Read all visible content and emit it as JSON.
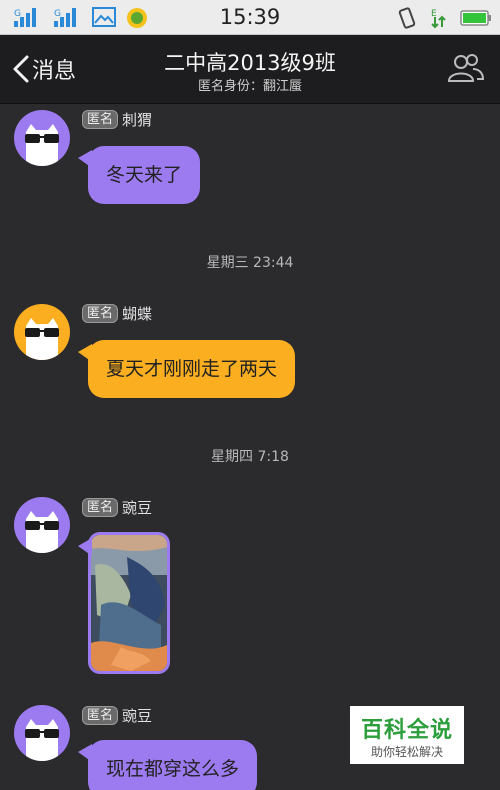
{
  "status_bar": {
    "time": "15:39",
    "signal1_label": "G",
    "signal2_label": "G",
    "data_label": "E"
  },
  "nav": {
    "back_label": "消息",
    "title": "二中高2013级9班",
    "subtitle": "匿名身份：翻江蜃"
  },
  "messages": [
    {
      "tag": "匿名",
      "nick": "刺猬",
      "text": "冬天来了",
      "color": "#9c7bf0"
    },
    {
      "tag": "匿名",
      "nick": "蝴蝶",
      "text": "夏天才刚刚走了两天",
      "color": "#fbae20"
    },
    {
      "tag": "匿名",
      "nick": "豌豆",
      "text": "",
      "color": "#9c7bf0"
    },
    {
      "tag": "匿名",
      "nick": "豌豆",
      "text": "现在都穿这么多",
      "color": "#9c7bf0"
    }
  ],
  "timestamps": [
    "星期三 23:44",
    "星期四 7:18"
  ],
  "watermark": {
    "main": "百科全说",
    "sub": "助你轻松解决"
  },
  "icons": {
    "back": "chevron-left-icon",
    "group": "group-members-icon",
    "avatar": "cat-sunglasses-avatar"
  }
}
